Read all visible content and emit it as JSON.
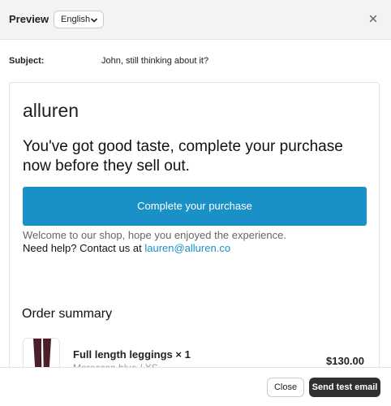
{
  "header": {
    "title": "Preview",
    "language": "English",
    "close_icon": "close-icon",
    "chevron_icon": "chevron-down-icon"
  },
  "subject": {
    "label": "Subject:",
    "value": "John, still thinking about it?"
  },
  "email": {
    "brand": "alluren",
    "headline": "You've got good taste, complete your purchase now before they sell out.",
    "cta_label": "Complete your purchase",
    "welcome": "Welcome to our shop, hope you enjoyed the experience.",
    "help_prefix": "Need help? Contact us at",
    "help_email": "lauren@alluren.co",
    "link_color": "#1990c6",
    "cta_color": "#1990c6",
    "order_summary": {
      "title": "Order summary",
      "items": [
        {
          "name": "Full length leggings × 1",
          "variant": "Moroccan blue / XS",
          "price": "$130.00",
          "thumbnail": "leggings-image"
        }
      ]
    }
  },
  "footer": {
    "close_label": "Close",
    "send_label": "Send test email"
  }
}
